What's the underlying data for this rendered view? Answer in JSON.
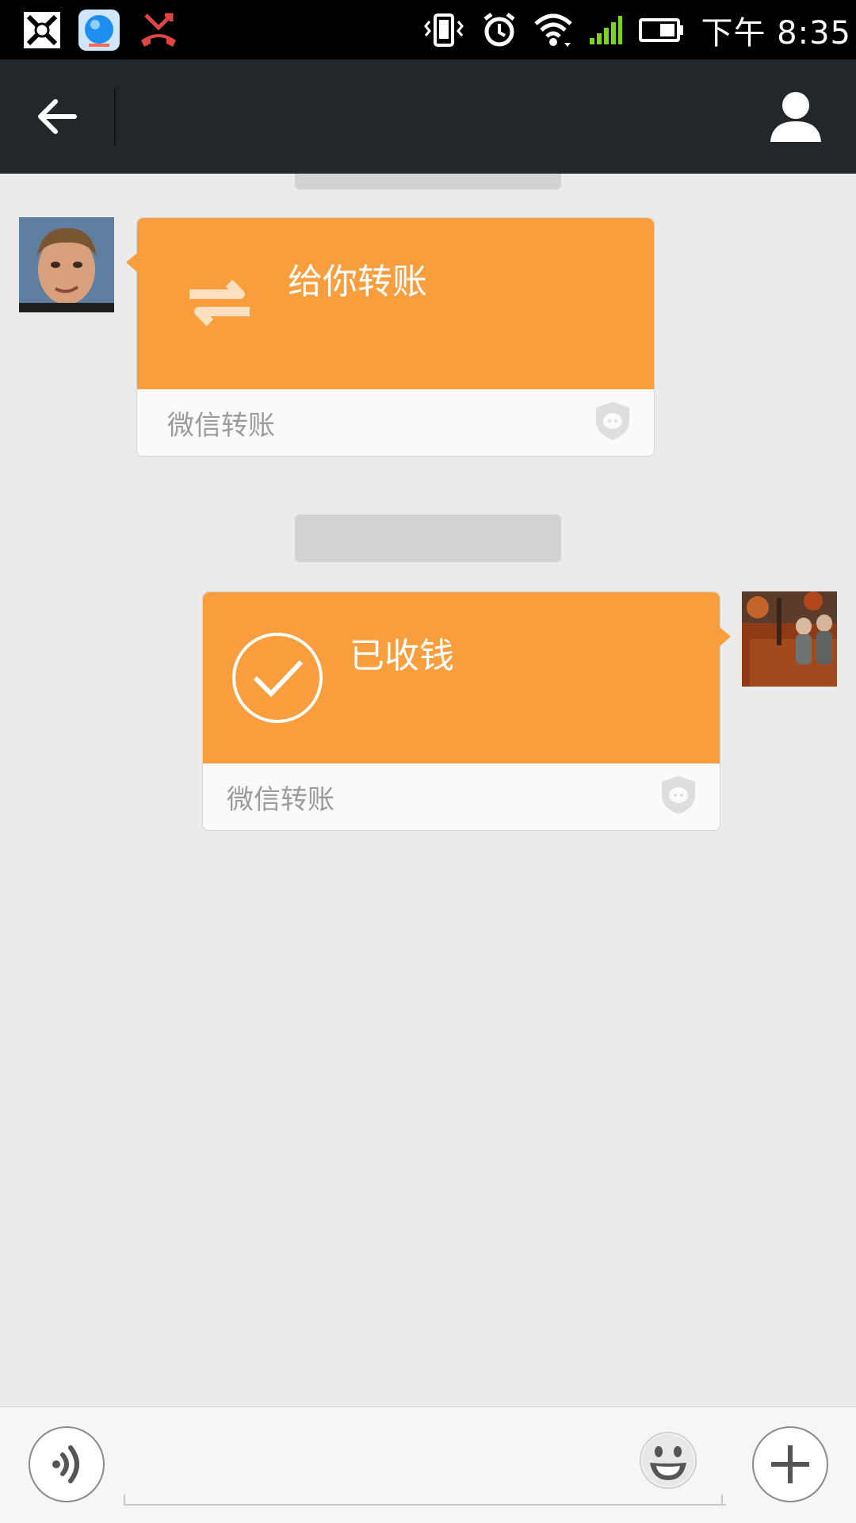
{
  "status_bar": {
    "time": "下午 8:35",
    "left_icons": [
      "app-notification-icon",
      "browser-icon",
      "missed-call-icon"
    ],
    "right_icons": [
      "vibrate-icon",
      "alarm-icon",
      "wifi-icon",
      "signal-icon",
      "battery-icon"
    ]
  },
  "action_bar": {
    "back_icon": "back-arrow-icon",
    "profile_icon": "profile-icon"
  },
  "chat": {
    "messages": [
      {
        "side": "left",
        "type": "transfer",
        "title": "给你转账",
        "footer": "微信转账",
        "icon": "transfer-arrows-icon"
      },
      {
        "side": "right",
        "type": "transfer",
        "title": "已收钱",
        "footer": "微信转账",
        "icon": "checkmark-circle-icon"
      }
    ]
  },
  "input_bar": {
    "voice_icon": "voice-icon",
    "emoji_icon": "emoji-icon",
    "plus_icon": "plus-icon",
    "input_value": ""
  },
  "colors": {
    "status_bar": "#000000",
    "action_bar": "#21272b",
    "chat_bg": "#ebebeb",
    "transfer_orange": "#f89e3c",
    "card_footer": "#fafafa"
  }
}
